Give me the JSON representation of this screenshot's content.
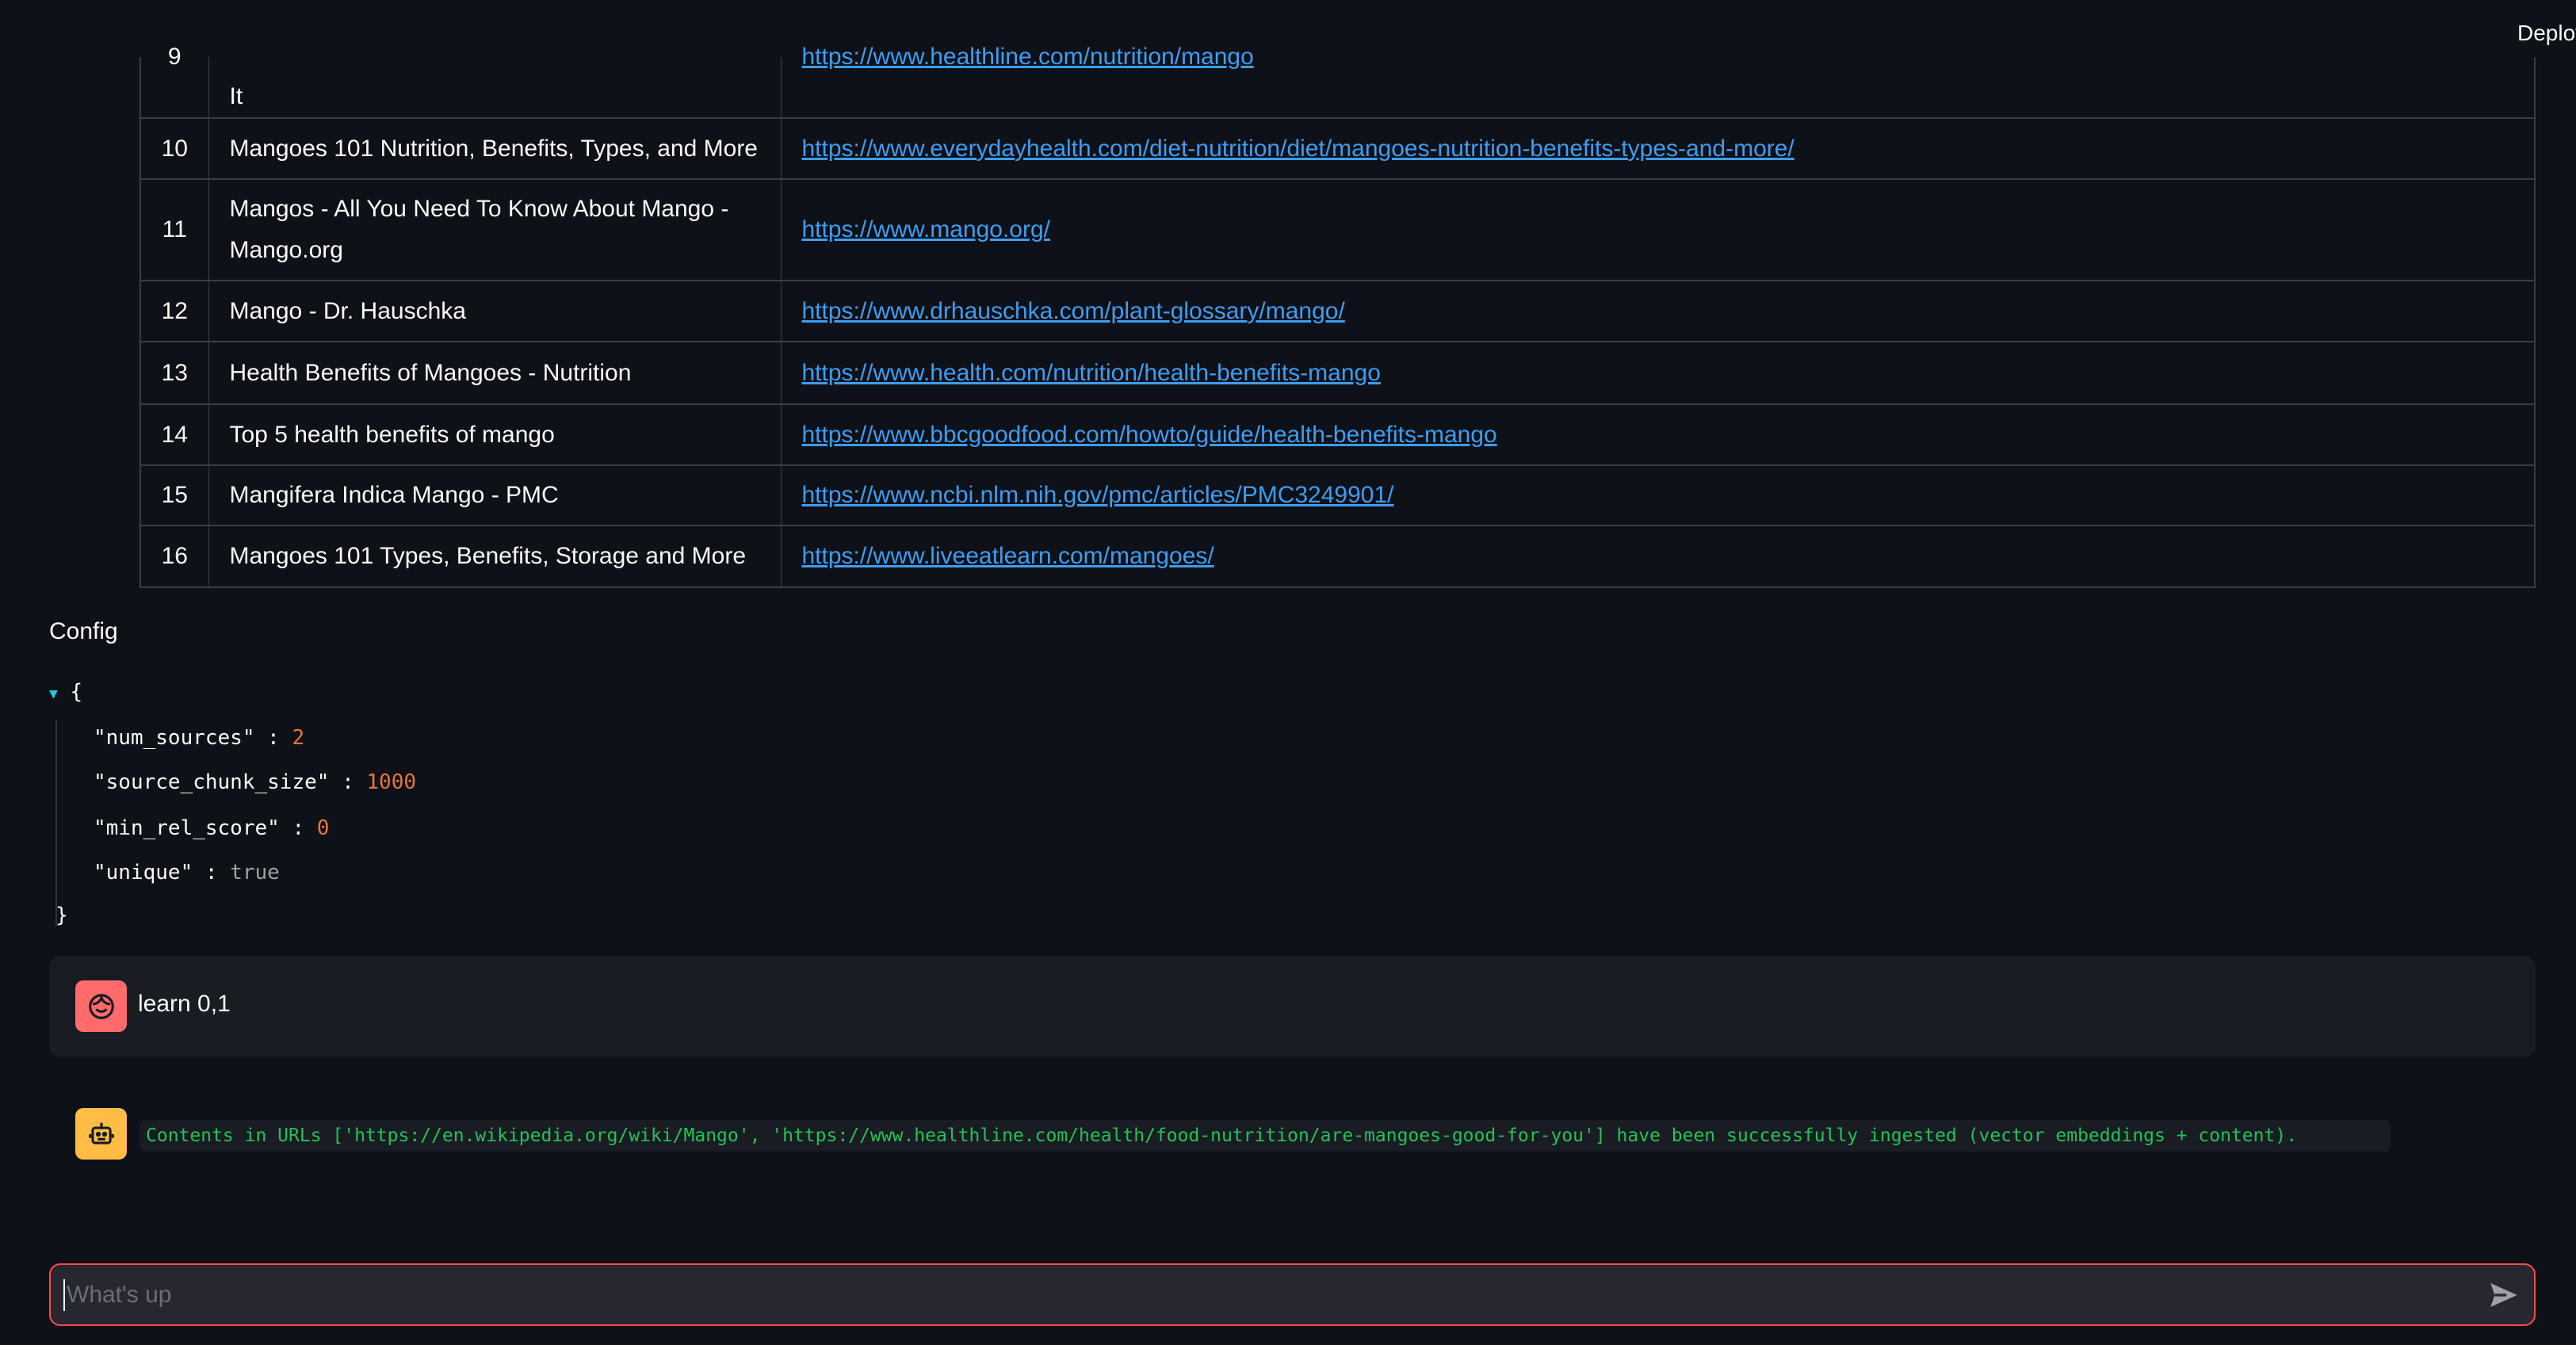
{
  "header": {
    "deploy_label": "Deploy"
  },
  "sources_table": {
    "rows": [
      {
        "num": "9",
        "title": "It",
        "url": "https://www.healthline.com/nutrition/mango"
      },
      {
        "num": "10",
        "title": "Mangoes 101 Nutrition, Benefits, Types, and More",
        "url": "https://www.everydayhealth.com/diet-nutrition/diet/mangoes-nutrition-benefits-types-and-more/"
      },
      {
        "num": "11",
        "title": "Mangos - All You Need To Know About Mango - Mango.org",
        "url": "https://www.mango.org/"
      },
      {
        "num": "12",
        "title": "Mango - Dr. Hauschka",
        "url": "https://www.drhauschka.com/plant-glossary/mango/"
      },
      {
        "num": "13",
        "title": "Health Benefits of Mangoes - Nutrition",
        "url": "https://www.health.com/nutrition/health-benefits-mango"
      },
      {
        "num": "14",
        "title": "Top 5 health benefits of mango",
        "url": "https://www.bbcgoodfood.com/howto/guide/health-benefits-mango"
      },
      {
        "num": "15",
        "title": "Mangifera Indica Mango - PMC",
        "url": "https://www.ncbi.nlm.nih.gov/pmc/articles/PMC3249901/"
      },
      {
        "num": "16",
        "title": "Mangoes 101 Types, Benefits, Storage and More",
        "url": "https://www.liveeatlearn.com/mangoes/"
      }
    ]
  },
  "config": {
    "label": "Config",
    "open_brace": "{",
    "close_brace": "}",
    "entries": [
      {
        "key": "\"num_sources\"",
        "value": "2"
      },
      {
        "key": "\"source_chunk_size\"",
        "value": "1000"
      },
      {
        "key": "\"min_rel_score\"",
        "value": "0"
      },
      {
        "key": "\"unique\"",
        "value": "true"
      }
    ]
  },
  "chat": {
    "user_message": "learn 0,1",
    "bot_message": "Contents in URLs ['https://en.wikipedia.org/wiki/Mango', 'https://www.healthline.com/health/food-nutrition/are-mangoes-good-for-you'] have been successfully ingested (vector embeddings + content).",
    "input_placeholder": "What's up"
  },
  "colors": {
    "accent": "#ff4b4b",
    "link": "#3d9df3",
    "success": "#21c354",
    "user_avatar": "#ff6b6b",
    "bot_avatar": "#ffbd45"
  }
}
